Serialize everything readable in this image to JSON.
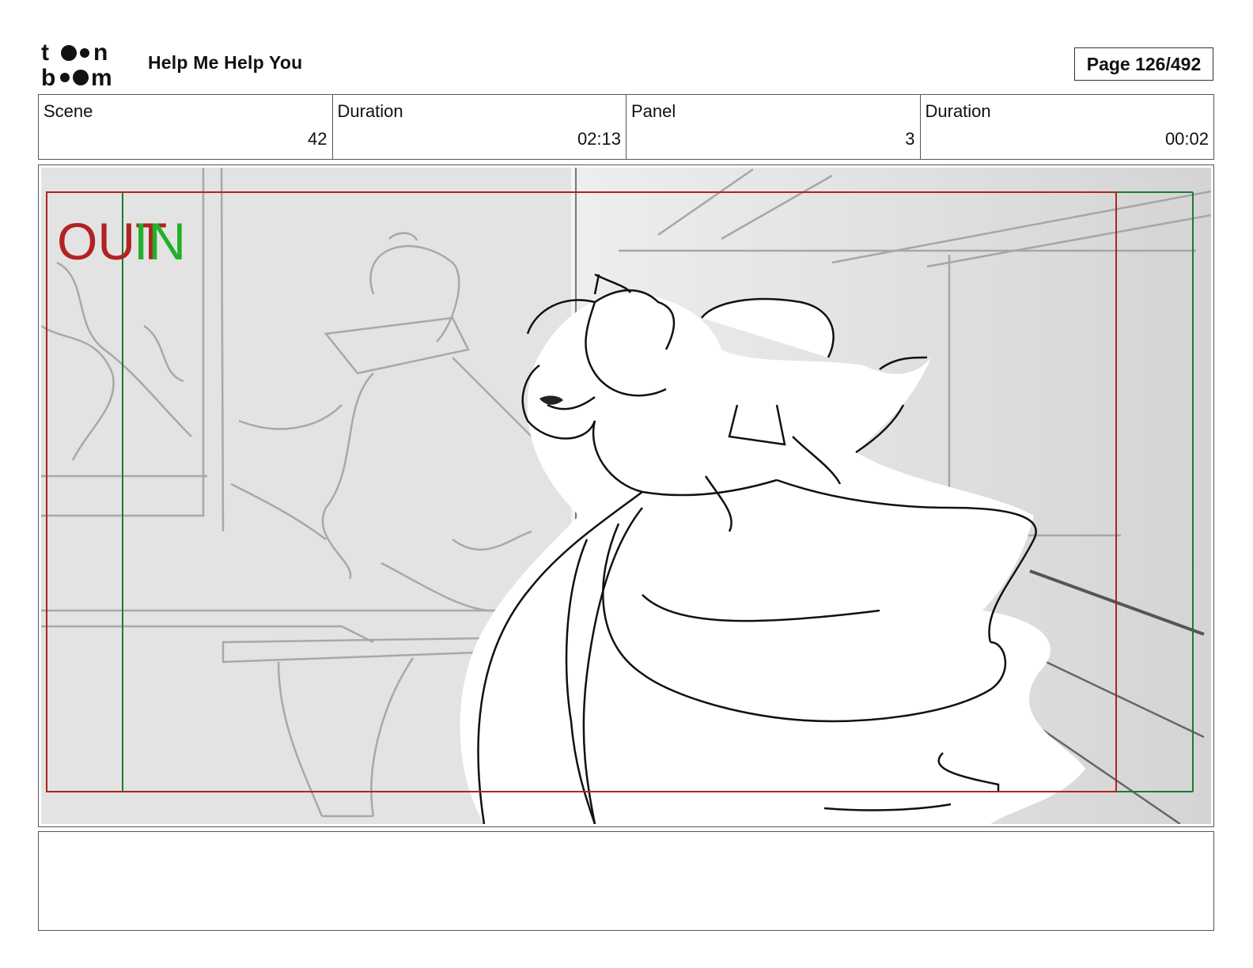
{
  "header": {
    "logo_text": "toonboom",
    "title": "Help Me Help You",
    "page": "Page 126/492"
  },
  "info": {
    "scene_label": "Scene",
    "scene_value": "42",
    "scene_duration_label": "Duration",
    "scene_duration_value": "02:13",
    "panel_label": "Panel",
    "panel_value": "3",
    "panel_duration_label": "Duration",
    "panel_duration_value": "00:02"
  },
  "panel": {
    "out_label": "OUT",
    "in_label": "IN",
    "colors": {
      "out_frame": "#b22222",
      "in_frame": "#1e7a2e",
      "in_text": "#22b02a",
      "background": "#e6e6e6"
    }
  },
  "notes": {
    "text": ""
  }
}
